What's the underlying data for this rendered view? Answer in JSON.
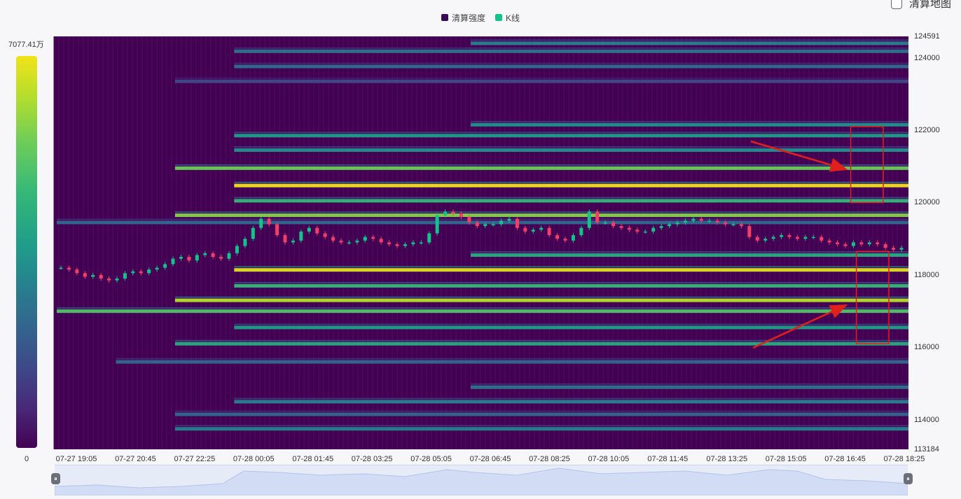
{
  "legend": {
    "items": [
      {
        "label": "清算强度",
        "color": "#3a0a57"
      },
      {
        "label": "K线",
        "color": "#14c28a"
      }
    ]
  },
  "toggle": {
    "label": "清算地图",
    "checked": false
  },
  "colorbar": {
    "max_label": "7077.41万",
    "min_label": "0"
  },
  "chart_data": {
    "type": "heatmap",
    "title": "",
    "x_labels": [
      "07-27 19:05",
      "07-27 20:45",
      "07-27 22:25",
      "07-28 00:05",
      "07-28 01:45",
      "07-28 03:25",
      "07-28 05:05",
      "07-28 06:45",
      "07-28 08:25",
      "07-28 10:05",
      "07-28 11:45",
      "07-28 13:25",
      "07-28 15:05",
      "07-28 16:45",
      "07-28 18:25"
    ],
    "y_ticks": [
      124591,
      124000,
      122000,
      120000,
      118000,
      116000,
      114000,
      113184
    ],
    "ylim": [
      113184,
      124591
    ],
    "colorscale": "viridis",
    "value_range_wan": [
      0,
      7077.41
    ],
    "liquidation_bands": [
      {
        "price": 124400,
        "start": "07-28 06:45",
        "intensity": 0.4
      },
      {
        "price": 124180,
        "start": "07-28 00:05",
        "intensity": 0.35
      },
      {
        "price": 123760,
        "start": "07-28 00:05",
        "intensity": 0.32
      },
      {
        "price": 123350,
        "start": "07-27 22:25",
        "intensity": 0.2
      },
      {
        "price": 122150,
        "start": "07-28 06:45",
        "intensity": 0.45
      },
      {
        "price": 121850,
        "start": "07-28 00:05",
        "intensity": 0.5
      },
      {
        "price": 121450,
        "start": "07-28 00:05",
        "intensity": 0.45
      },
      {
        "price": 120950,
        "start": "07-27 22:25",
        "intensity": 0.7
      },
      {
        "price": 120470,
        "start": "07-28 00:05",
        "intensity": 1.0
      },
      {
        "price": 120050,
        "start": "07-28 00:05",
        "intensity": 0.6
      },
      {
        "price": 119650,
        "start": "07-27 22:25",
        "intensity": 0.75
      },
      {
        "price": 119450,
        "start": "07-27 19:05",
        "intensity": 0.3
      },
      {
        "price": 118550,
        "start": "07-28 06:45",
        "intensity": 0.55
      },
      {
        "price": 118140,
        "start": "07-28 00:05",
        "intensity": 0.95
      },
      {
        "price": 117700,
        "start": "07-28 00:05",
        "intensity": 0.6
      },
      {
        "price": 117300,
        "start": "07-27 22:25",
        "intensity": 0.85
      },
      {
        "price": 117000,
        "start": "07-27 19:05",
        "intensity": 0.65
      },
      {
        "price": 116550,
        "start": "07-28 00:05",
        "intensity": 0.5
      },
      {
        "price": 116100,
        "start": "07-27 22:25",
        "intensity": 0.55
      },
      {
        "price": 115600,
        "start": "07-27 20:45",
        "intensity": 0.3
      },
      {
        "price": 114900,
        "start": "07-28 06:45",
        "intensity": 0.35
      },
      {
        "price": 114500,
        "start": "07-28 00:05",
        "intensity": 0.4
      },
      {
        "price": 114150,
        "start": "07-27 22:25",
        "intensity": 0.3
      },
      {
        "price": 113750,
        "start": "07-27 22:25",
        "intensity": 0.4
      }
    ],
    "kline": {
      "x_start": "07-27 19:05",
      "x_end": "07-28 18:25",
      "close": [
        118200,
        118150,
        118050,
        117950,
        118000,
        117900,
        117850,
        117900,
        118050,
        118100,
        118050,
        118150,
        118200,
        118300,
        118450,
        118500,
        118400,
        118550,
        118600,
        118500,
        118450,
        118600,
        118800,
        119000,
        119300,
        119550,
        119400,
        119100,
        118900,
        118950,
        119200,
        119300,
        119150,
        119050,
        118950,
        118900,
        118900,
        118950,
        119050,
        119000,
        118900,
        118850,
        118800,
        118850,
        118900,
        118900,
        119150,
        119650,
        119750,
        119700,
        119600,
        119450,
        119350,
        119400,
        119400,
        119500,
        119550,
        119300,
        119200,
        119250,
        119300,
        119100,
        119000,
        118950,
        119100,
        119300,
        119750,
        119450,
        119450,
        119350,
        119300,
        119250,
        119200,
        119200,
        119300,
        119350,
        119400,
        119450,
        119500,
        119550,
        119500,
        119500,
        119450,
        119400,
        119400,
        119350,
        119050,
        118950,
        119000,
        119050,
        119100,
        119050,
        119000,
        119050,
        119050,
        118950,
        118900,
        118850,
        118800,
        118900,
        118850,
        118900,
        118850,
        118750,
        118700,
        118750
      ]
    }
  },
  "highlights": [
    {
      "label": "upper-box",
      "price_top": 122100,
      "price_bottom": 120000,
      "x_from": "07-28 16:45",
      "x_to": "07-28 18:25"
    },
    {
      "label": "lower-box",
      "price_top": 118650,
      "price_bottom": 116100,
      "x_from": "07-28 16:45",
      "x_to": "07-28 18:25"
    }
  ]
}
